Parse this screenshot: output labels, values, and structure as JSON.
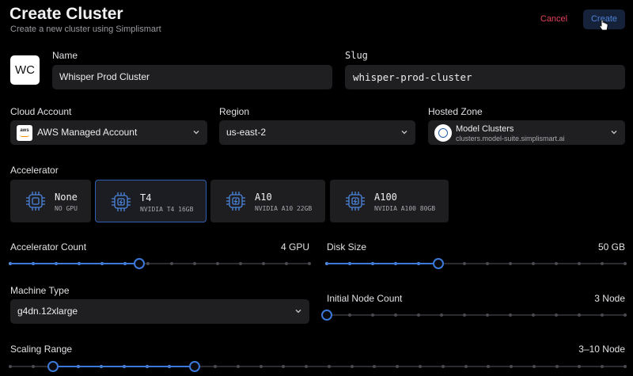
{
  "header": {
    "title": "Create Cluster",
    "subtitle": "Create a new cluster using Simplismart",
    "cancel_label": "Cancel",
    "create_label": "Create"
  },
  "avatar": {
    "initials": "WC"
  },
  "name_field": {
    "label": "Name",
    "value": "Whisper Prod Cluster"
  },
  "slug_field": {
    "label": "Slug",
    "value": "whisper-prod-cluster"
  },
  "cloud_account": {
    "label": "Cloud Account",
    "value": "AWS Managed Account",
    "logo_text": "aws"
  },
  "region": {
    "label": "Region",
    "value": "us-east-2"
  },
  "hosted_zone": {
    "label": "Hosted Zone",
    "name": "Model Clusters",
    "domain": "clusters.model-suite.simplismart.ai"
  },
  "accelerator": {
    "label": "Accelerator",
    "selected": "T4",
    "options": [
      {
        "name": "None",
        "sub": "NO GPU"
      },
      {
        "name": "T4",
        "sub": "NVIDIA T4 16GB"
      },
      {
        "name": "A10",
        "sub": "NVIDIA A10 22GB"
      },
      {
        "name": "A100",
        "sub": "NVIDIA A100 80GB"
      }
    ]
  },
  "accelerator_count": {
    "label": "Accelerator Count",
    "display": "4 GPU",
    "value": 4,
    "min": 1,
    "max": 8
  },
  "disk_size": {
    "label": "Disk Size",
    "display": "50 GB",
    "value_fraction": 0.375
  },
  "machine_type": {
    "label": "Machine Type",
    "value": "g4dn.12xlarge"
  },
  "initial_node_count": {
    "label": "Initial Node Count",
    "display": "3 Node",
    "value_fraction": 0
  },
  "scaling_range": {
    "label": "Scaling Range",
    "display": "3–10 Node",
    "low_fraction": 0.07,
    "high_fraction": 0.3
  },
  "colors": {
    "accent": "#3b78d8",
    "danger": "#e0435a",
    "background": "#000000",
    "field": "#1f1f22"
  }
}
